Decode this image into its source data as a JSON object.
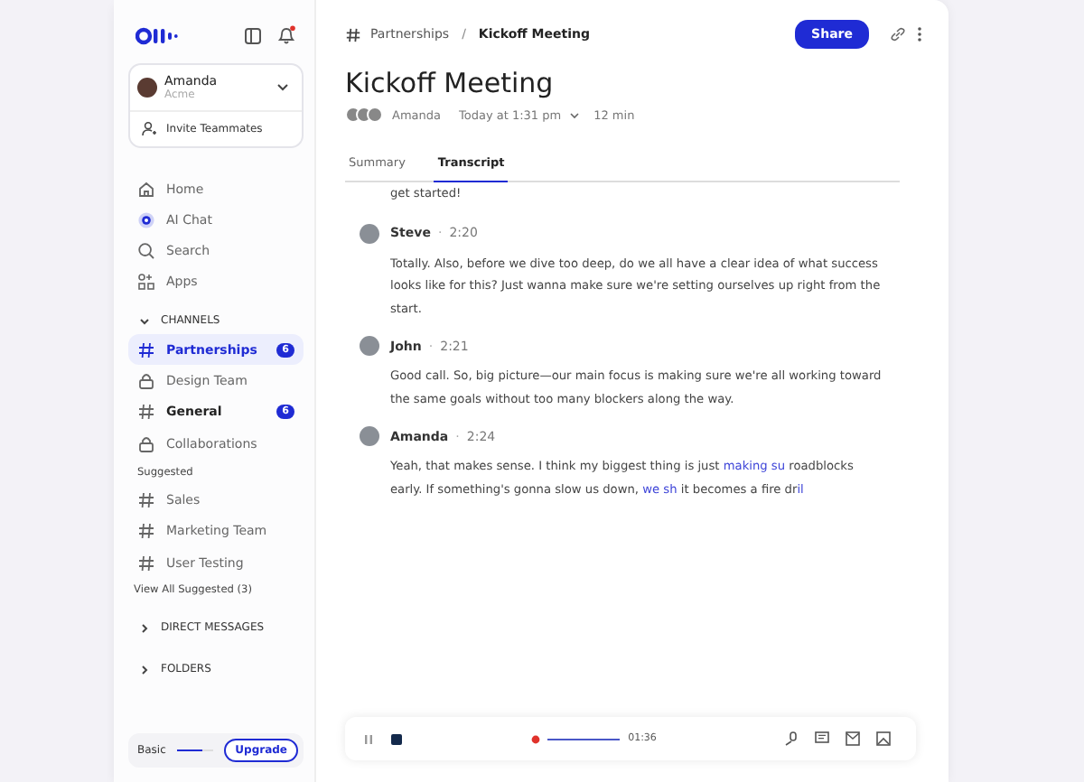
{
  "sidebar": {
    "account": {
      "name": "Amanda",
      "org": "Acme",
      "action": "Invite Teammates"
    },
    "nav": [
      {
        "label": "Home",
        "kind": "home"
      },
      {
        "label": "AI Chat",
        "kind": "chat"
      },
      {
        "label": "Search",
        "kind": "search"
      },
      {
        "label": "Apps",
        "kind": "apps"
      }
    ],
    "channels_heading": "CHANNELS",
    "channels": [
      {
        "label": "Partnerships",
        "kind": "hash",
        "selected": true,
        "unread": true,
        "badge": "6"
      },
      {
        "label": "Design Team",
        "kind": "lock",
        "selected": false,
        "unread": false
      },
      {
        "label": "General",
        "kind": "hash",
        "selected": false,
        "unread": true,
        "badge": "6"
      },
      {
        "label": "Collaborations",
        "kind": "lock",
        "selected": false,
        "unread": false
      }
    ],
    "suggested_heading": "Suggested",
    "suggested": [
      {
        "label": "Sales"
      },
      {
        "label": "Marketing Team"
      },
      {
        "label": "User Testing"
      }
    ],
    "view_all": "View All Suggested (3)",
    "sections": [
      {
        "label": "DIRECT MESSAGES",
        "expanded": false
      },
      {
        "label": "FOLDERS",
        "expanded": false
      }
    ],
    "plan": {
      "label": "Basic",
      "level": 0.7,
      "button": "Upgrade"
    }
  },
  "header": {
    "channel": "Partnerships",
    "separator": "/",
    "page": "Kickoff Meeting",
    "share": "Share"
  },
  "meeting": {
    "title": "Kickoff Meeting",
    "owner": "Amanda",
    "date": "Today at 1:31 pm",
    "duration": "12 min"
  },
  "tabs": [
    {
      "label": "Summary",
      "selected": false
    },
    {
      "label": "Transcript",
      "selected": true
    }
  ],
  "transcript": {
    "lead": "get started!",
    "entries": [
      {
        "speaker": "Steve",
        "separator": "·",
        "time": "2:20",
        "segments": [
          {
            "text": "Totally. Also, before we dive too deep, do we all have a clear idea of what success looks like for this? Just wanna make sure we're setting ourselves up right from the start.",
            "live": false
          }
        ]
      },
      {
        "speaker": "John",
        "separator": "·",
        "time": "2:21",
        "segments": [
          {
            "text": "Good call. So, big picture—our main focus is making sure we're all working toward the same goals without too many blockers along the way.",
            "live": false
          }
        ]
      },
      {
        "speaker": "Amanda",
        "separator": "·",
        "time": "2:24",
        "segments": [
          {
            "text": "Yeah, that makes sense. I think my biggest thing is just ",
            "live": false
          },
          {
            "text": "making su",
            "live": true
          },
          {
            "text": " roadblocks early. If something's gonna slow us down, ",
            "live": false
          },
          {
            "text": "we sh",
            "live": true
          },
          {
            "text": " it becomes a fire dr",
            "live": false
          },
          {
            "text": "il",
            "live": true
          }
        ]
      }
    ]
  },
  "player": {
    "elapsed": "01:36"
  }
}
